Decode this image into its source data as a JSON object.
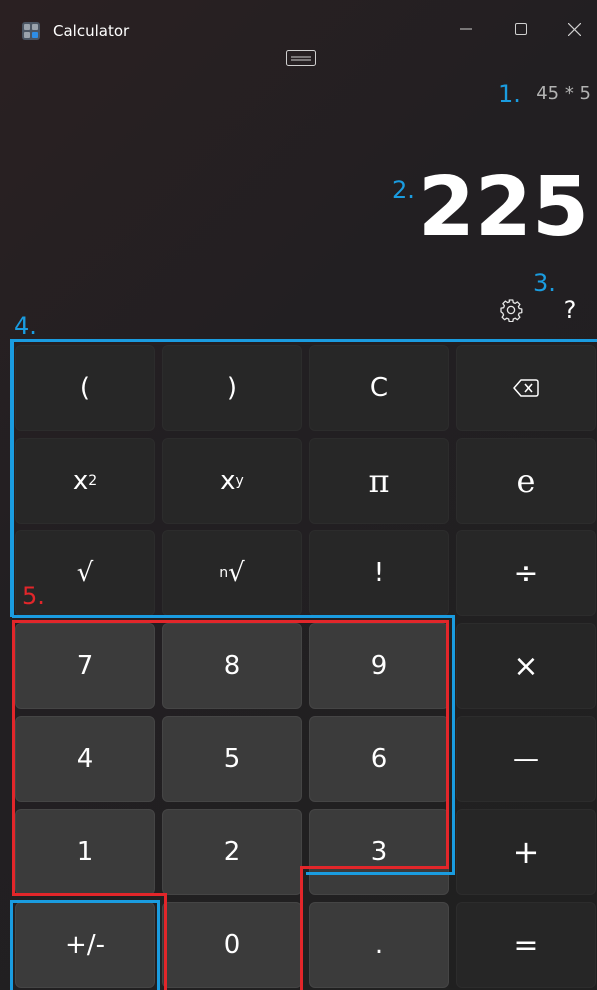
{
  "window": {
    "title": "Calculator",
    "icons": {
      "app": "calculator-icon",
      "minimize": "minimize-icon",
      "maximize": "maximize-icon",
      "close": "close-icon",
      "keep_on_top": "keep-on-top-icon",
      "settings": "gear-icon",
      "help": "help-icon",
      "backspace": "backspace-icon"
    }
  },
  "display": {
    "expression": "45 * 5",
    "result": "225"
  },
  "annotations": {
    "c1": "1.",
    "c2": "2.",
    "c3": "3.",
    "c4": "4.",
    "c5": "5.",
    "blue": "#1a9ce0",
    "red": "#e2262a"
  },
  "help_label": "?",
  "keys": {
    "open_paren": "(",
    "close_paren": ")",
    "clear": "C",
    "x_squared_base": "x",
    "x_squared_exp": "2",
    "x_power_base": "x",
    "x_power_exp": "y",
    "pi": "π",
    "e": "e",
    "sqrt": "√",
    "nth_root_n": "n",
    "nth_root_sym": "√",
    "factorial": "!",
    "divide": "÷",
    "seven": "7",
    "eight": "8",
    "nine": "9",
    "multiply": "×",
    "four": "4",
    "five": "5",
    "six": "6",
    "minus": "—",
    "one": "1",
    "two": "2",
    "three": "3",
    "plus": "+",
    "negate": "+/-",
    "zero": "0",
    "decimal": ".",
    "equals": "="
  }
}
